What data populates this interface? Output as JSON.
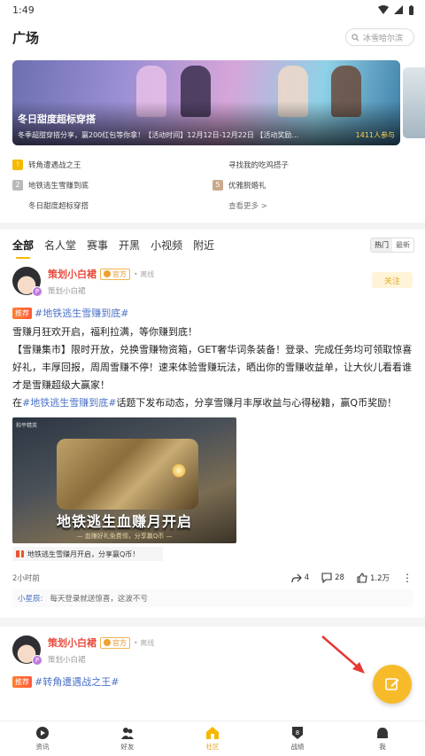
{
  "status": {
    "time": "1:49"
  },
  "header": {
    "title": "广场",
    "search_placeholder": "冰雪哈尔滨"
  },
  "banner": {
    "title": "冬日甜度超标穿搭",
    "subtitle": "冬季超甜穿搭分享，赢200红包等你拿！【活动时间】12月12日-12月22日 【活动奖励…",
    "participants": "1411人参与"
  },
  "topics": {
    "items": [
      {
        "rank": "",
        "label": "转角遭遇战之王",
        "rank_style": "r1"
      },
      {
        "rank": "",
        "label": "寻找我的吃鸡搭子",
        "rank_style": "blank"
      },
      {
        "rank": "2",
        "label": "地铁逃生雪赚到底",
        "rank_style": "r2"
      },
      {
        "rank": "5",
        "label": "优雅脱婚礼",
        "rank_style": "r3"
      },
      {
        "rank": "",
        "label": "冬日甜度超标穿搭",
        "rank_style": "blank"
      },
      {
        "rank": "",
        "label": "查看更多 >",
        "rank_style": "blank"
      }
    ]
  },
  "tabs": {
    "items": [
      "全部",
      "名人堂",
      "赛事",
      "开黑",
      "小视频",
      "附近"
    ],
    "sort": [
      "热门",
      "最新"
    ]
  },
  "post1": {
    "username": "策划小白裙",
    "official": "官方",
    "status": "离线",
    "subname": "策划小白裙",
    "follow": "关注",
    "tag_badge": "推荐",
    "hashtag": "#地铁逃生雪赚到底#",
    "line1": "雪赚月狂欢开启，福利拉满，等你赚到底！",
    "line2": "【雪赚集市】限时开放，兑换雪赚物资箱，GET奢华词条装备！登录、完成任务均可领取惊喜好礼，丰厚回报，周周雪赚不停！速来体验雪赚玩法，晒出你的雪赚收益单，让大伙儿看看谁才是雪赚超级大赢家！",
    "line3_prefix": "在",
    "line3_hashtag": "#地铁逃生雪赚到底#",
    "line3_suffix": "话题下发布动态，分享雪赚月丰厚收益与心得秘籍，赢Q币奖励！",
    "image_title": "地铁逃生血赚月开启",
    "image_sub": "— 血赚好礼免费领，分享赢Q币 —",
    "image_corner": "和平精英",
    "link_card": "地铁逃生雪赚月开启，分享赢Q币！",
    "time": "2小时前",
    "shares": "4",
    "comments": "28",
    "likes": "1.2万",
    "comment_user": "小星辰:",
    "comment_text": "每天登录就送惊喜，这波不亏"
  },
  "post2": {
    "username": "策划小白裙",
    "official": "官方",
    "status": "离线",
    "subname": "策划小白裙",
    "tag_badge": "推荐",
    "hashtag": "#转角遭遇战之王#"
  },
  "nav": {
    "items": [
      "资讯",
      "好友",
      "社区",
      "战绩",
      "我"
    ],
    "active": "社区"
  },
  "colors": {
    "accent": "#f7bb2a",
    "username": "#e84c3d",
    "hashtag": "#4b72c7"
  }
}
